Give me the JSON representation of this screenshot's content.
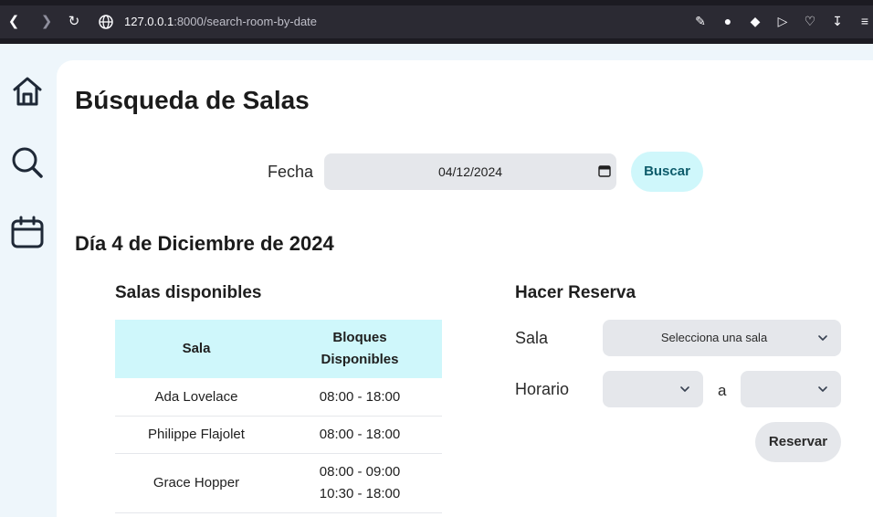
{
  "browser": {
    "url_host": "127.0.0.1",
    "url_rest": ":8000/search-room-by-date",
    "toolbar_icons": [
      "edit-icon",
      "camera-icon",
      "shield-icon",
      "play-icon",
      "heart-icon",
      "download-icon",
      "menu-icon"
    ]
  },
  "sidebar": {
    "items": [
      {
        "icon": "home-icon"
      },
      {
        "icon": "search-icon"
      },
      {
        "icon": "calendar-icon"
      }
    ]
  },
  "page": {
    "title": "Búsqueda de Salas",
    "date_label": "Fecha",
    "date_value": "04/12/2024",
    "search_button": "Buscar",
    "day_title": "Día 4 de Diciembre de 2024"
  },
  "available": {
    "title": "Salas disponibles",
    "headers": [
      "Sala",
      "Bloques",
      "Disponibles"
    ],
    "rows": [
      {
        "sala": "Ada Lovelace",
        "bloques": [
          "08:00 - 18:00"
        ]
      },
      {
        "sala": "Philippe Flajolet",
        "bloques": [
          "08:00 - 18:00"
        ]
      },
      {
        "sala": "Grace Hopper",
        "bloques": [
          "08:00 - 09:00",
          "10:30 - 18:00"
        ]
      }
    ]
  },
  "reservation": {
    "title": "Hacer Reserva",
    "sala_label": "Sala",
    "sala_placeholder": "Selecciona una sala",
    "horario_label": "Horario",
    "to_label": "a",
    "submit_button": "Reservar"
  }
}
